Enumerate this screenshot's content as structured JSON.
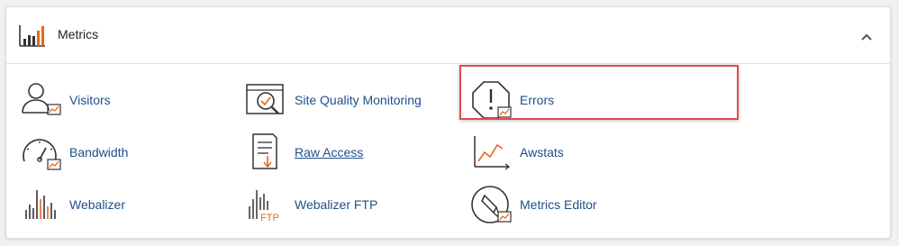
{
  "section": {
    "title": "Metrics",
    "icon": "bar-chart-icon",
    "collapse_icon": "chevron-up-icon"
  },
  "colors": {
    "link": "#1e4f8a",
    "accent": "#e8681a",
    "highlight": "#e24b4b"
  },
  "items": [
    {
      "label": "Visitors",
      "icon": "visitors-icon"
    },
    {
      "label": "Site Quality Monitoring",
      "icon": "site-quality-icon"
    },
    {
      "label": "Errors",
      "icon": "errors-icon"
    },
    {
      "label": "Bandwidth",
      "icon": "bandwidth-icon"
    },
    {
      "label": "Raw Access",
      "icon": "raw-access-icon"
    },
    {
      "label": "Awstats",
      "icon": "awstats-icon"
    },
    {
      "label": "Webalizer",
      "icon": "webalizer-icon"
    },
    {
      "label": "Webalizer FTP",
      "icon": "webalizer-ftp-icon",
      "icon_text": "FTP"
    },
    {
      "label": "Metrics Editor",
      "icon": "metrics-editor-icon"
    }
  ]
}
